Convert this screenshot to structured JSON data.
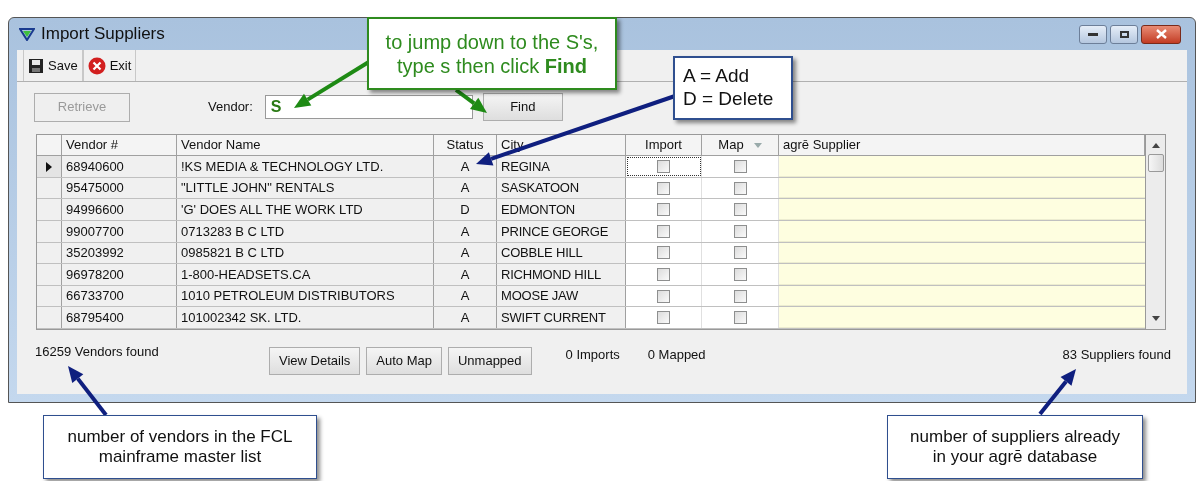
{
  "window": {
    "title": "Import Suppliers"
  },
  "toolbar": [
    {
      "kind": "save",
      "label": "Save"
    },
    {
      "kind": "exit",
      "label": "Exit"
    }
  ],
  "search": {
    "retrieve": {
      "label": "Retrieve",
      "disabled": true
    },
    "vendor_label": "Vendor:",
    "value": "S",
    "find": "Find"
  },
  "table": {
    "columns": [
      "Vendor #",
      "Vendor Name",
      "Status",
      "City",
      "Import",
      "Map",
      "agrē Supplier"
    ],
    "rows": [
      {
        "selected": true,
        "vendor": "68940600",
        "name": "!KS MEDIA & TECHNOLOGY LTD.",
        "status": "A",
        "city": "REGINA",
        "import": false,
        "map": false
      },
      {
        "selected": false,
        "vendor": "95475000",
        "name": "\"LITTLE JOHN\" RENTALS",
        "status": "A",
        "city": "SASKATOON",
        "import": false,
        "map": false
      },
      {
        "selected": false,
        "vendor": "94996600",
        "name": "'G' DOES ALL THE WORK LTD",
        "status": "D",
        "city": "EDMONTON",
        "import": false,
        "map": false
      },
      {
        "selected": false,
        "vendor": "99007700",
        "name": "0713283 B C LTD",
        "status": "A",
        "city": "PRINCE GEORGE",
        "import": false,
        "map": false
      },
      {
        "selected": false,
        "vendor": "35203992",
        "name": "0985821 B C LTD",
        "status": "A",
        "city": "COBBLE HILL",
        "import": false,
        "map": false
      },
      {
        "selected": false,
        "vendor": "96978200",
        "name": "1-800-HEADSETS.CA",
        "status": "A",
        "city": "RICHMOND HILL",
        "import": false,
        "map": false
      },
      {
        "selected": false,
        "vendor": "66733700",
        "name": "1010 PETROLEUM DISTRIBUTORS",
        "status": "A",
        "city": "MOOSE JAW",
        "import": false,
        "map": false
      },
      {
        "selected": false,
        "vendor": "68795400",
        "name": "101002342 SK. LTD.",
        "status": "A",
        "city": "SWIFT CURRENT",
        "import": false,
        "map": false
      }
    ]
  },
  "footer": {
    "vendors_found": "16259 Vendors found",
    "buttons": [
      "View Details",
      "Auto Map",
      "Unmapped"
    ],
    "imports": "0 Imports",
    "mapped": "0 Mapped",
    "suppliers_found": "83 Suppliers found"
  },
  "callouts": [
    {
      "lines": [
        "to jump down to the S's,",
        "type s then click **Find**"
      ],
      "color": "#2e8b1e"
    },
    {
      "lines": [
        "A = Add",
        "D = Delete"
      ],
      "color": "#2f4f8f"
    },
    {
      "lines": [
        "number of vendors in the FCL",
        "mainframe master list"
      ],
      "color": "#2f4f8f"
    },
    {
      "lines": [
        "number of suppliers already",
        "in your agrē database"
      ],
      "color": "#2f4f8f"
    }
  ]
}
